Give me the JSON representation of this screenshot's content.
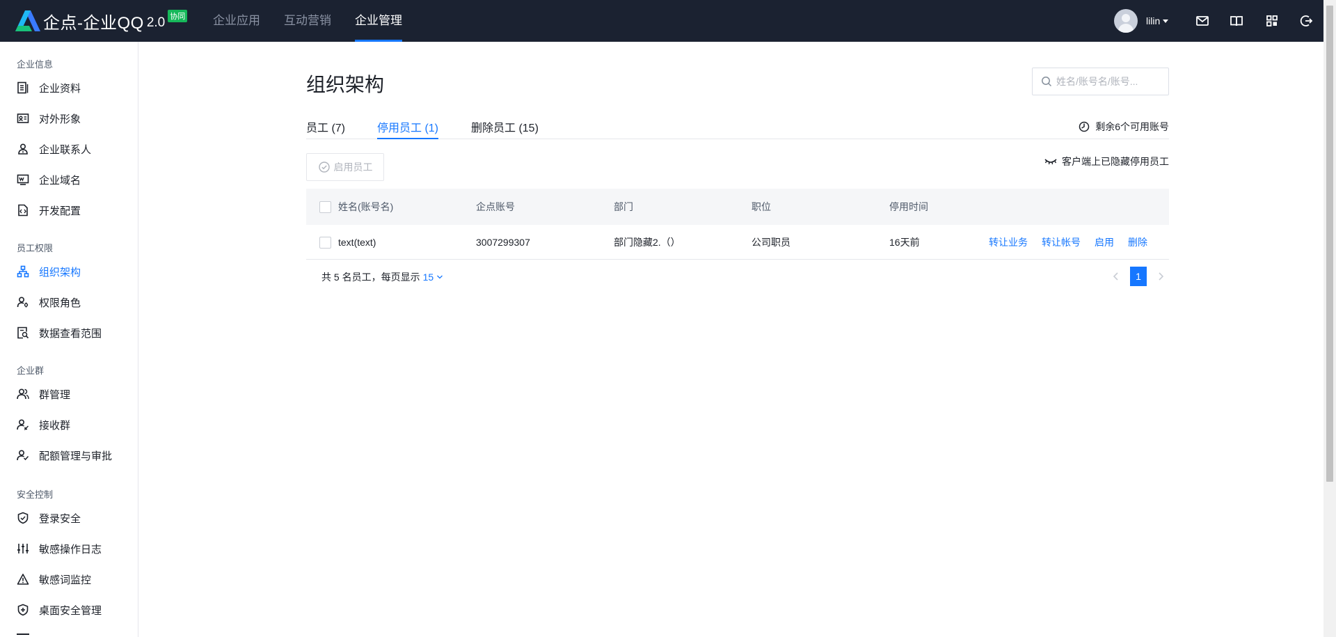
{
  "brand": {
    "name": "企点-企业QQ",
    "version": "2.0",
    "badge": "协同"
  },
  "nav": {
    "items": [
      {
        "label": "企业应用",
        "active": false
      },
      {
        "label": "互动营销",
        "active": false
      },
      {
        "label": "企业管理",
        "active": true
      }
    ]
  },
  "user": {
    "name": "lilin"
  },
  "top_icons": [
    "mail-icon",
    "book-icon",
    "apps-grid-icon",
    "logout-icon"
  ],
  "sidebar": {
    "groups": [
      {
        "title": "企业信息",
        "items": [
          {
            "label": "企业资料",
            "icon": "document-icon"
          },
          {
            "label": "对外形象",
            "icon": "id-card-icon"
          },
          {
            "label": "企业联系人",
            "icon": "contact-person-icon"
          },
          {
            "label": "企业域名",
            "icon": "domain-icon"
          },
          {
            "label": "开发配置",
            "icon": "code-config-icon"
          }
        ]
      },
      {
        "title": "员工权限",
        "items": [
          {
            "label": "组织架构",
            "icon": "org-chart-icon",
            "active": true
          },
          {
            "label": "权限角色",
            "icon": "role-icon"
          },
          {
            "label": "数据查看范围",
            "icon": "data-scope-icon"
          }
        ]
      },
      {
        "title": "企业群",
        "items": [
          {
            "label": "群管理",
            "icon": "group-icon"
          },
          {
            "label": "接收群",
            "icon": "receive-group-icon"
          },
          {
            "label": "配额管理与审批",
            "icon": "quota-approval-icon"
          }
        ]
      },
      {
        "title": "安全控制",
        "items": [
          {
            "label": "登录安全",
            "icon": "shield-check-icon"
          },
          {
            "label": "敏感操作日志",
            "icon": "sliders-icon"
          },
          {
            "label": "敏感词监控",
            "icon": "warning-icon"
          },
          {
            "label": "桌面安全管理",
            "icon": "shield-plus-icon"
          }
        ]
      }
    ]
  },
  "main": {
    "title": "组织架构",
    "search_placeholder": "姓名/账号名/账号...",
    "tabs": [
      {
        "label": "员工 (7)",
        "active": false
      },
      {
        "label": "停用员工 (1)",
        "active": true
      },
      {
        "label": "删除员工 (15)",
        "active": false
      }
    ],
    "quota_text": "剩余6个可用账号",
    "enable_button": "启用员工",
    "hidden_note": "客户端上已隐藏停用员工",
    "table": {
      "columns": [
        "姓名(账号名)",
        "企点账号",
        "部门",
        "职位",
        "停用时间"
      ],
      "rows": [
        {
          "name": "text(text)",
          "account": "3007299307",
          "department": "部门隐藏2.（）",
          "position": "公司职员",
          "disabled_time": "16天前",
          "actions": [
            "转让业务",
            "转让帐号",
            "启用",
            "删除"
          ]
        }
      ]
    },
    "footer": {
      "total_text": "共 5 名员工，每页显示",
      "page_size": "15",
      "current_page": "1"
    }
  },
  "colors": {
    "topbar": "#1b2231",
    "accent": "#1677ff",
    "badge": "#16b85a"
  }
}
